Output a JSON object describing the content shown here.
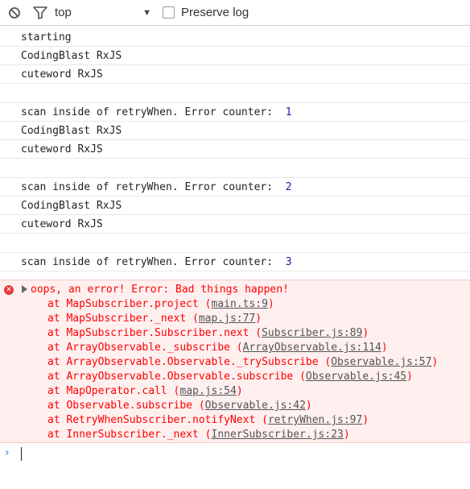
{
  "toolbar": {
    "clear_icon": "block-icon",
    "filter_icon": "filter-icon",
    "context": "top",
    "context_caret": "▼",
    "preserve_label": "Preserve log"
  },
  "log": [
    {
      "text": "starting"
    },
    {
      "text": "CodingBlast RxJS"
    },
    {
      "text": "cuteword RxJS"
    },
    {
      "text": ""
    },
    {
      "text": "scan inside of retryWhen. Error counter:  ",
      "num": "1"
    },
    {
      "text": "CodingBlast RxJS"
    },
    {
      "text": "cuteword RxJS"
    },
    {
      "text": ""
    },
    {
      "text": "scan inside of retryWhen. Error counter:  ",
      "num": "2"
    },
    {
      "text": "CodingBlast RxJS"
    },
    {
      "text": "cuteword RxJS"
    },
    {
      "text": ""
    },
    {
      "text": "scan inside of retryWhen. Error counter:  ",
      "num": "3"
    }
  ],
  "error": {
    "message": "oops, an error! Error: Bad things happen!",
    "trace": [
      {
        "prefix": "at MapSubscriber.project (",
        "link": "main.ts:9",
        "suffix": ")"
      },
      {
        "prefix": "at MapSubscriber._next (",
        "link": "map.js:77",
        "suffix": ")"
      },
      {
        "prefix": "at MapSubscriber.Subscriber.next (",
        "link": "Subscriber.js:89",
        "suffix": ")"
      },
      {
        "prefix": "at ArrayObservable._subscribe (",
        "link": "ArrayObservable.js:114",
        "suffix": ")"
      },
      {
        "prefix": "at ArrayObservable.Observable._trySubscribe (",
        "link": "Observable.js:57",
        "suffix": ")"
      },
      {
        "prefix": "at ArrayObservable.Observable.subscribe (",
        "link": "Observable.js:45",
        "suffix": ")"
      },
      {
        "prefix": "at MapOperator.call (",
        "link": "map.js:54",
        "suffix": ")"
      },
      {
        "prefix": "at Observable.subscribe (",
        "link": "Observable.js:42",
        "suffix": ")"
      },
      {
        "prefix": "at RetryWhenSubscriber.notifyNext (",
        "link": "retryWhen.js:97",
        "suffix": ")"
      },
      {
        "prefix": "at InnerSubscriber._next (",
        "link": "InnerSubscriber.js:23",
        "suffix": ")"
      }
    ]
  },
  "prompt": {
    "symbol": "›"
  }
}
